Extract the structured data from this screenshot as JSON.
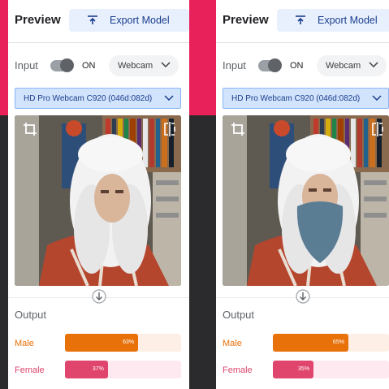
{
  "screens": [
    {
      "header": {
        "title": "Preview",
        "export_label": "Export Model"
      },
      "input": {
        "label": "Input",
        "toggle_state": "ON",
        "source": "Webcam"
      },
      "device": "HD Pro Webcam C920 (046d:082d)",
      "output": {
        "label": "Output",
        "classes": [
          {
            "name": "Male",
            "percent": 63,
            "percent_label": "63%",
            "color": "#e8710a",
            "track": "#fdeee6"
          },
          {
            "name": "Female",
            "percent": 37,
            "percent_label": "37%",
            "color": "#e0466d",
            "track": "#fde9ef"
          }
        ]
      }
    },
    {
      "header": {
        "title": "Preview",
        "export_label": "Export Model"
      },
      "input": {
        "label": "Input",
        "toggle_state": "ON",
        "source": "Webcam"
      },
      "device": "HD Pro Webcam C920 (046d:082d)",
      "output": {
        "label": "Output",
        "classes": [
          {
            "name": "Male",
            "percent": 65,
            "percent_label": "65%",
            "color": "#e8710a",
            "track": "#fdeee6"
          },
          {
            "name": "Female",
            "percent": 35,
            "percent_label": "35%",
            "color": "#e0466d",
            "track": "#fde9ef"
          }
        ]
      }
    }
  ],
  "icons": [
    "upload-icon",
    "chevron-down-icon",
    "crop-icon",
    "flip-icon",
    "arrow-down-circle-icon"
  ],
  "colors": {
    "background_top": "#e8215a",
    "background_bottom": "#2b2b2d",
    "accent_blue": "#1a3e8c"
  }
}
